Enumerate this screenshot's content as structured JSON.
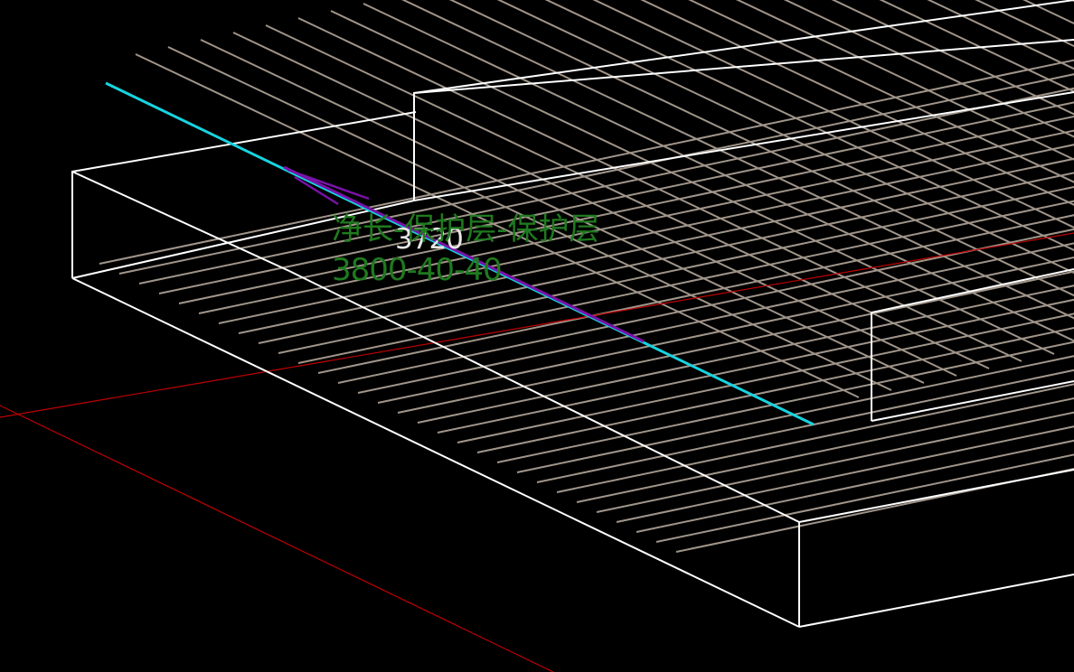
{
  "view": {
    "background": "#000000",
    "colors": {
      "slab_edge": "#ffffff",
      "rebar": "#a0958a",
      "axis": "#c00000",
      "selected_bar": "#17d4e0",
      "dimension": "#7a12a8",
      "dimension_text": "#e6e6e6",
      "annotation_text": "#1f7a1f"
    }
  },
  "annotation": {
    "dimension_value": "3720",
    "formula": "净长-保护层-保护层",
    "value": "3800-40-40"
  }
}
